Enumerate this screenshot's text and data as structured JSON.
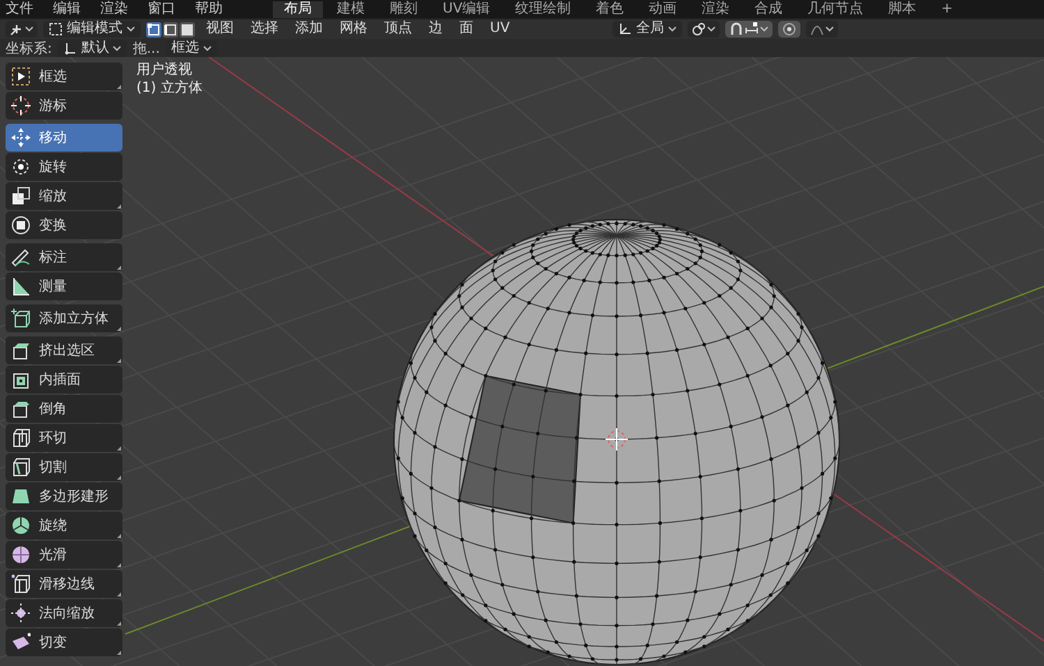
{
  "menu_bar": {
    "items": [
      "文件",
      "编辑",
      "渲染",
      "窗口",
      "帮助"
    ]
  },
  "workspace_tabs": [
    {
      "label": "布局",
      "selected": true
    },
    {
      "label": "建模",
      "selected": false
    },
    {
      "label": "雕刻",
      "selected": false
    },
    {
      "label": "UV编辑",
      "selected": false
    },
    {
      "label": "纹理绘制",
      "selected": false
    },
    {
      "label": "着色",
      "selected": false
    },
    {
      "label": "动画",
      "selected": false
    },
    {
      "label": "渲染",
      "selected": false
    },
    {
      "label": "合成",
      "selected": false
    },
    {
      "label": "几何节点",
      "selected": false
    },
    {
      "label": "脚本",
      "selected": false
    },
    {
      "label": "+",
      "selected": false
    }
  ],
  "header": {
    "mode": "编辑模式",
    "select_modes": [
      {
        "selected": true
      },
      {
        "selected": false
      },
      {
        "selected": false
      }
    ],
    "menus": [
      "视图",
      "选择",
      "添加",
      "网格",
      "顶点",
      "边",
      "面",
      "UV"
    ],
    "orientation": "全局"
  },
  "tool_settings": {
    "label": "坐标系:",
    "orientation": "默认",
    "drag_label": "拖...",
    "drag_value": "框选"
  },
  "toolbar": {
    "groups": [
      [
        {
          "label": "框选",
          "selected": false,
          "has_variants": true
        },
        {
          "label": "游标",
          "selected": false,
          "has_variants": false
        }
      ],
      [
        {
          "label": "移动",
          "selected": true,
          "has_variants": false
        },
        {
          "label": "旋转",
          "selected": false,
          "has_variants": false
        },
        {
          "label": "缩放",
          "selected": false,
          "has_variants": true
        },
        {
          "label": "变换",
          "selected": false,
          "has_variants": false
        }
      ],
      [
        {
          "label": "标注",
          "selected": false,
          "has_variants": true
        },
        {
          "label": "测量",
          "selected": false,
          "has_variants": false
        }
      ],
      [
        {
          "label": "添加立方体",
          "selected": false,
          "has_variants": true
        }
      ],
      [
        {
          "label": "挤出选区",
          "selected": false,
          "has_variants": true
        },
        {
          "label": "内插面",
          "selected": false,
          "has_variants": false
        },
        {
          "label": "倒角",
          "selected": false,
          "has_variants": false
        },
        {
          "label": "环切",
          "selected": false,
          "has_variants": true
        },
        {
          "label": "切割",
          "selected": false,
          "has_variants": true
        },
        {
          "label": "多边形建形",
          "selected": false,
          "has_variants": false
        },
        {
          "label": "旋绕",
          "selected": false,
          "has_variants": true
        },
        {
          "label": "光滑",
          "selected": false,
          "has_variants": true
        },
        {
          "label": "滑移边线",
          "selected": false,
          "has_variants": true
        },
        {
          "label": "法向缩放",
          "selected": false,
          "has_variants": true
        },
        {
          "label": "切变",
          "selected": false,
          "has_variants": true
        }
      ]
    ]
  },
  "viewport": {
    "view_name": "用户透视",
    "object_name": "(1) 立方体"
  }
}
